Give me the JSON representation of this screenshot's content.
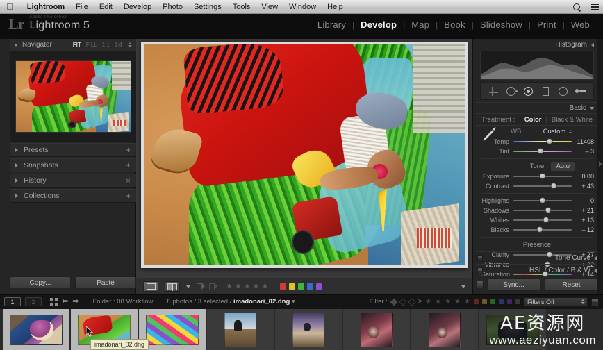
{
  "macmenu": {
    "apple_icon": "apple-icon",
    "items": [
      {
        "label": "Lightroom",
        "bold": true
      },
      {
        "label": "File",
        "bold": false
      },
      {
        "label": "Edit",
        "bold": false
      },
      {
        "label": "Develop",
        "bold": false
      },
      {
        "label": "Photo",
        "bold": false
      },
      {
        "label": "Settings",
        "bold": false
      },
      {
        "label": "Tools",
        "bold": false
      },
      {
        "label": "View",
        "bold": false
      },
      {
        "label": "Window",
        "bold": false
      },
      {
        "label": "Help",
        "bold": false
      }
    ],
    "right_icons": [
      "search-icon",
      "list-icon"
    ]
  },
  "identity": {
    "logo": "Lr",
    "sub": "Adobe Photoshop",
    "main": "Lightroom 5"
  },
  "modules": [
    {
      "label": "Library",
      "active": false
    },
    {
      "label": "Develop",
      "active": true
    },
    {
      "label": "Map",
      "active": false
    },
    {
      "label": "Book",
      "active": false
    },
    {
      "label": "Slideshow",
      "active": false
    },
    {
      "label": "Print",
      "active": false
    },
    {
      "label": "Web",
      "active": false
    }
  ],
  "left_panel": {
    "navigator": {
      "title": "Navigator",
      "zoom_levels": [
        {
          "label": "FIT",
          "active": true
        },
        {
          "label": "FILL",
          "active": false
        },
        {
          "label": "1:1",
          "active": false
        },
        {
          "label": "1:4",
          "active": false
        }
      ]
    },
    "sections": [
      {
        "label": "Presets",
        "action": "+"
      },
      {
        "label": "Snapshots",
        "action": "+"
      },
      {
        "label": "History",
        "action": "×"
      },
      {
        "label": "Collections",
        "action": "+"
      }
    ],
    "buttons": {
      "copy": "Copy...",
      "paste": "Paste"
    }
  },
  "right_panel": {
    "histogram_title": "Histogram",
    "tools": [
      "crop-overlay-icon",
      "spot-removal-icon",
      "red-eye-icon",
      "graduated-filter-icon",
      "adjustment-brush-icon"
    ],
    "basic_title": "Basic",
    "treatment": {
      "label": "Treatment :",
      "color": "Color",
      "bw": "Black & White",
      "active": "Color"
    },
    "wb": {
      "label": "WB :",
      "value": "Custom"
    },
    "wb_sliders": [
      {
        "name": "Temp",
        "value": "11408",
        "pos": 62
      },
      {
        "name": "Tint",
        "value": "– 3",
        "pos": 47
      }
    ],
    "tone": {
      "title": "Tone",
      "auto": "Auto",
      "sliders": [
        {
          "name": "Exposure",
          "value": "0.00",
          "pos": 50
        },
        {
          "name": "Contrast",
          "value": "+ 43",
          "pos": 69
        }
      ]
    },
    "tone2": [
      {
        "name": "Highlights",
        "value": "0",
        "pos": 50
      },
      {
        "name": "Shadows",
        "value": "+ 21",
        "pos": 59
      },
      {
        "name": "Whites",
        "value": "+ 13",
        "pos": 56
      },
      {
        "name": "Blacks",
        "value": "– 12",
        "pos": 45
      }
    ],
    "presence": {
      "title": "Presence",
      "sliders": [
        {
          "name": "Clarity",
          "value": "+ 27",
          "pos": 62
        },
        {
          "name": "Vibrance",
          "value": "+ 22",
          "pos": 58
        },
        {
          "name": "Saturation",
          "value": "+ 14",
          "pos": 55
        }
      ]
    },
    "sections": [
      {
        "label": "Tone Curve"
      },
      {
        "label": "HSL / Color / B & W"
      }
    ],
    "buttons": {
      "sync": "Sync...",
      "reset": "Reset"
    }
  },
  "toolbar": {
    "view_icon": "loupe-view-icon",
    "compare_icon": "before-after-icon",
    "flag_icons": [
      "flag-pick-icon",
      "flag-reject-icon"
    ],
    "stars": 5,
    "color_labels": [
      "#d03a3a",
      "#d8c52e",
      "#3fb53f",
      "#3a68cc",
      "#8c4fd0"
    ],
    "dropdown_icon": "chevron-down-icon"
  },
  "filmstrip_bar": {
    "screen1": "1",
    "screen2": "2",
    "grid_icon": "grid-view-icon",
    "back_icon": "arrow-left-icon",
    "forward_icon": "arrow-right-icon",
    "folder": "Folder : 08 Workflow",
    "selection_prefix": "8 photos / 3 selected / ",
    "filename": "imadonari_02.dng",
    "filter_label": "Filter :",
    "filter_preset": "Filters Off"
  },
  "filmstrip": {
    "thumbs": [
      {
        "name": "thumb-1",
        "cls": "t1",
        "selected": true,
        "tall": false
      },
      {
        "name": "thumb-2",
        "cls": "t2",
        "selected": true,
        "tall": false
      },
      {
        "name": "thumb-3",
        "cls": "t3",
        "selected": true,
        "tall": false
      },
      {
        "name": "thumb-4",
        "cls": "t4",
        "selected": false,
        "tall": true
      },
      {
        "name": "thumb-5",
        "cls": "t5",
        "selected": false,
        "tall": true
      },
      {
        "name": "thumb-6",
        "cls": "t6",
        "selected": false,
        "tall": true
      },
      {
        "name": "thumb-7",
        "cls": "t7",
        "selected": false,
        "tall": true
      },
      {
        "name": "thumb-8",
        "cls": "t8",
        "selected": false,
        "tall": false
      }
    ]
  },
  "tooltip": "imadonari_02.dng",
  "watermark": {
    "cn": "AE资源网",
    "en": "www.aeziyuan.com"
  }
}
